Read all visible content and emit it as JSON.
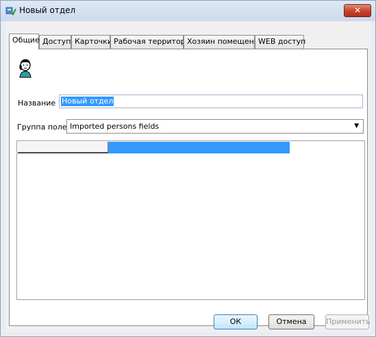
{
  "window": {
    "title": "Новый отдел",
    "close_symbol": "✕"
  },
  "tabs": [
    {
      "label": "Общие",
      "active": true
    },
    {
      "label": "Доступ",
      "active": false
    },
    {
      "label": "Карточки",
      "active": false
    },
    {
      "label": "Рабочая территория",
      "active": false
    },
    {
      "label": "Хозяин помещения",
      "active": false
    },
    {
      "label": "WEB доступ",
      "active": false
    }
  ],
  "general": {
    "avatar_icon": "person-icon",
    "name_label": "Название",
    "name_value": "Новый отдел",
    "group_label": "Группа полей",
    "group_value": "Imported persons fields",
    "dropdown_symbol": "▼"
  },
  "buttons": {
    "ok": "ОК",
    "cancel": "Отмена",
    "apply": "Применить"
  },
  "colors": {
    "selection": "#3399ff",
    "close_button": "#c9472f"
  }
}
